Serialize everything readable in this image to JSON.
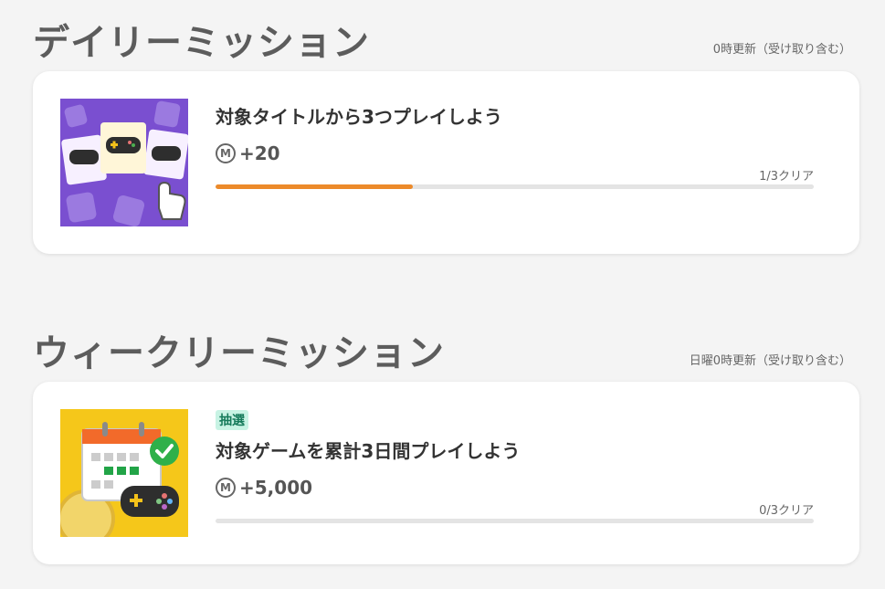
{
  "daily": {
    "title": "デイリーミッション",
    "note": "0時更新（受け取り含む）",
    "mission": {
      "title": "対象タイトルから3つプレイしよう",
      "coin_symbol": "M",
      "reward": "+20",
      "progress_text": "1/3クリア",
      "progress": 0.33,
      "progress_color": "#ec8a2a",
      "image_icon": "controller-cards-icon"
    }
  },
  "weekly": {
    "title": "ウィークリーミッション",
    "note": "日曜0時更新（受け取り含む）",
    "mission": {
      "tag": "抽選",
      "title": "対象ゲームを累計3日間プレイしよう",
      "coin_symbol": "M",
      "reward": "+5,000",
      "progress_text": "0/3クリア",
      "progress": 0.0,
      "progress_color": "#ec8a2a",
      "image_icon": "calendar-controller-icon"
    }
  },
  "colors": {
    "background": "#f4f4f4",
    "card": "#ffffff",
    "accent": "#ec8a2a",
    "tag_bg": "#c8f3e4"
  }
}
